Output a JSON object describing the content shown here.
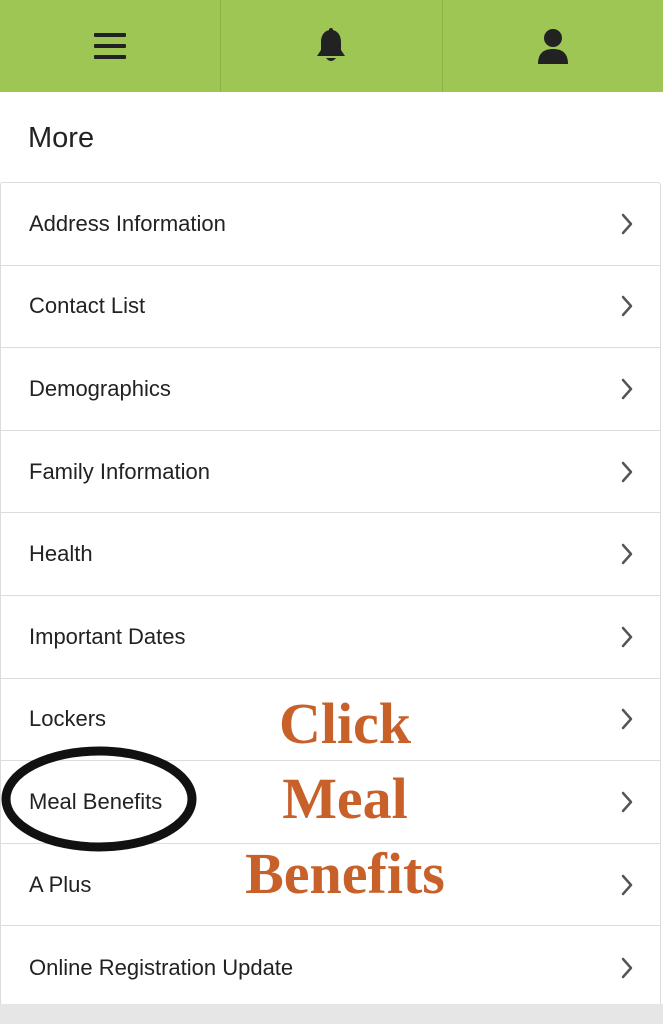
{
  "header": {
    "menu_icon": "hamburger-menu-icon",
    "notifications_icon": "bell-icon",
    "profile_icon": "user-icon",
    "background_color": "#9dc655"
  },
  "page": {
    "title": "More"
  },
  "menu": {
    "items": [
      {
        "label": "Address Information"
      },
      {
        "label": "Contact List"
      },
      {
        "label": "Demographics"
      },
      {
        "label": "Family Information"
      },
      {
        "label": "Health"
      },
      {
        "label": "Important Dates"
      },
      {
        "label": "Lockers"
      },
      {
        "label": "Meal Benefits"
      },
      {
        "label": "A Plus"
      },
      {
        "label": "Online Registration Update"
      }
    ]
  },
  "annotation": {
    "line1": "Click",
    "line2": "Meal",
    "line3": "Benefits",
    "color": "#c8602a"
  }
}
